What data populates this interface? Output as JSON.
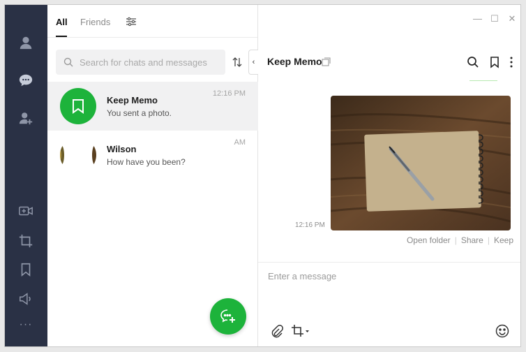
{
  "colors": {
    "rail": "#2a3145",
    "accent": "#1db33b",
    "selected_row": "#f1f1f2"
  },
  "rail": {
    "icons": [
      "profile-icon",
      "chats-icon",
      "add-friend-icon",
      "video-call-icon",
      "screenshot-icon",
      "keep-icon",
      "announcement-icon",
      "more-icon"
    ],
    "more_label": "···"
  },
  "tabs": {
    "all": "All",
    "friends": "Friends"
  },
  "search": {
    "placeholder": "Search for chats and messages"
  },
  "collapse_glyph": "‹",
  "chats": [
    {
      "name": "Keep Memo",
      "preview": "You sent a photo.",
      "time": "12:16 PM",
      "selected": true
    },
    {
      "name": "Wilson",
      "preview": "How have you been?",
      "time": "AM",
      "selected": false
    }
  ],
  "window_controls": {
    "minimize": "—",
    "maximize": "☐",
    "close": "✕"
  },
  "chat": {
    "title": "Keep Memo",
    "message_time": "12:16 PM",
    "photo_actions": {
      "open_folder": "Open folder",
      "share": "Share",
      "keep": "Keep"
    },
    "composer_placeholder": "Enter a message"
  }
}
